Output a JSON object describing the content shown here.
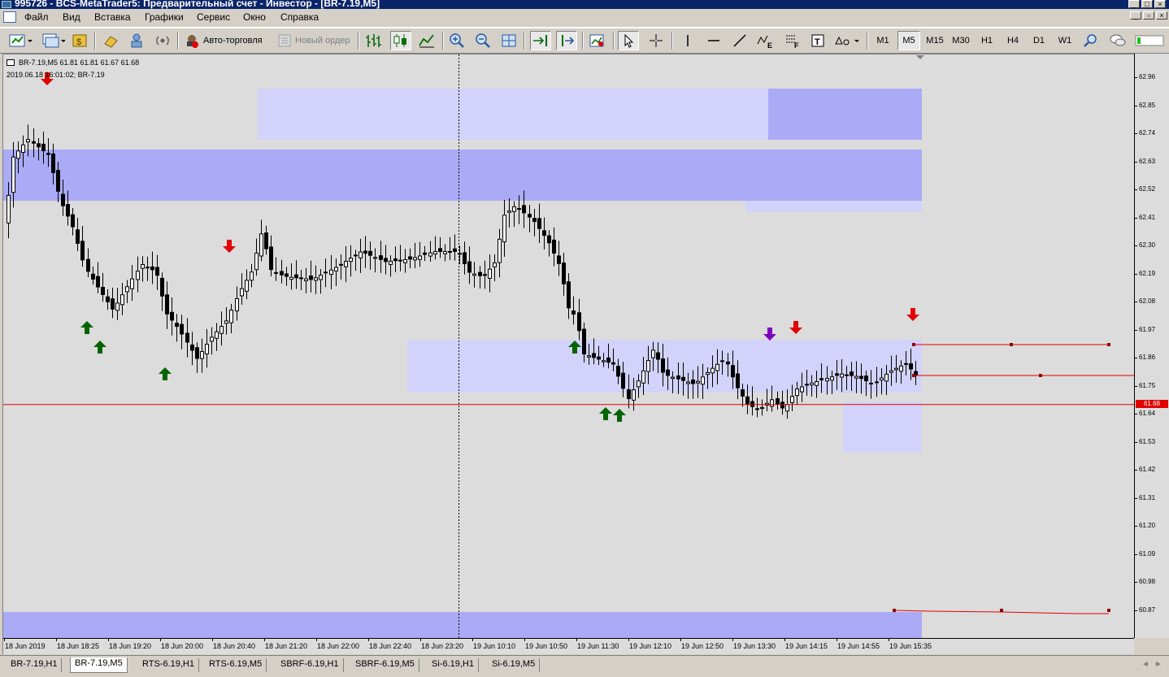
{
  "window": {
    "title": "995726 - BCS-MetaTrader5: Предварительный счет - Инвестор - [BR-7.19,M5]"
  },
  "menu": {
    "items": [
      "Файл",
      "Вид",
      "Вставка",
      "Графики",
      "Сервис",
      "Окно",
      "Справка"
    ]
  },
  "toolbar": {
    "auto_trading": "Авто-торговля",
    "new_order": "Новый ордер",
    "timeframes": [
      "M1",
      "M5",
      "M15",
      "M30",
      "H1",
      "H4",
      "D1",
      "W1"
    ],
    "active_timeframe": "M5"
  },
  "chart": {
    "info_line": "BR-7.19,M5  61.81 61.81 61.67 61.68",
    "crosshair_info": "2019.06.18 16:01:02; BR-7.19",
    "price_labels": [
      "62.96",
      "62.85",
      "62.74",
      "62.63",
      "62.52",
      "62.41",
      "62.30",
      "62.19",
      "62.08",
      "61.97",
      "61.86",
      "61.75",
      "61.64",
      "61.53",
      "61.42",
      "61.31",
      "61.20",
      "61.09",
      "60.98",
      "60.87"
    ],
    "current_price": "61.68",
    "time_labels": [
      "18 Jun 2019",
      "18 Jun 18:25",
      "18 Jun 19:20",
      "18 Jun 20:00",
      "18 Jun 20:40",
      "18 Jun 21:20",
      "18 Jun 22:00",
      "18 Jun 22:40",
      "18 Jun 23:20",
      "19 Jun 10:10",
      "19 Jun 10:50",
      "19 Jun 11:30",
      "19 Jun 12:10",
      "19 Jun 12:50",
      "19 Jun 13:30",
      "19 Jun 14:15",
      "19 Jun 14:55",
      "19 Jun 15:35"
    ],
    "colors": {
      "background": "#dcdcdc",
      "zone_light": "#d2d2fa",
      "zone_dark": "#aaaaf6",
      "up_arrow": "#006400",
      "down_arrow": "#e00000",
      "purple_arrow": "#8000c0",
      "price_line": "#e00000"
    }
  },
  "tabs": {
    "items": [
      "BR-7.19,H1",
      "BR-7.19,M5",
      "RTS-6.19,H1",
      "RTS-6.19,M5",
      "SBRF-6.19,H1",
      "SBRF-6.19,M5",
      "Si-6.19,H1",
      "Si-6.19,M5"
    ],
    "active": "BR-7.19,M5"
  }
}
